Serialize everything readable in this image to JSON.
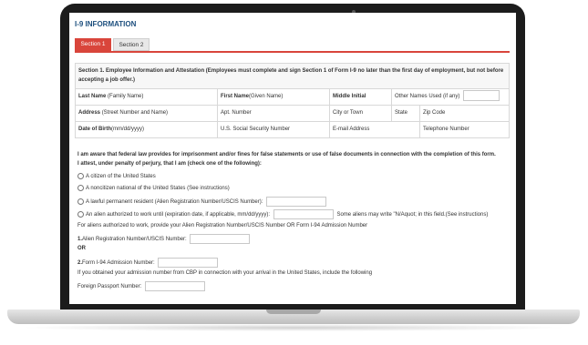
{
  "title": "I-9 INFORMATION",
  "tabs": [
    "Section 1",
    "Section 2"
  ],
  "section_header": "Section 1. Employee Information and Attestation (Employees must complete and sign Section 1 of Form I-9 no later than the first day of employment, but not before accepting a job offer.)",
  "row1": {
    "last_name_label": "Last Name",
    "last_name_hint": "(Family Name)",
    "first_name_label": "First Name",
    "first_name_hint": "(Given Name)",
    "middle_initial": "Middle Initial",
    "other_names": "Other Names Used (if any)"
  },
  "row2": {
    "address_label": "Address",
    "address_hint": "(Street Number and Name)",
    "apt": "Apt. Number",
    "city": "City or Town",
    "state": "State",
    "zip": "Zip Code"
  },
  "row3": {
    "dob_label": "Date of Birth",
    "dob_hint": "(mm/dd/yyyy)",
    "ssn": "U.S. Social Security Number",
    "email": "E-mail Address",
    "phone": "Telephone Number"
  },
  "attest1": "I am aware that federal law provides for imprisonment and/or fines for false statements or use of false documents in connection with the completion of this form.",
  "attest2": "I attest, under penalty of perjury, that I am (check one of the following):",
  "options": {
    "citizen": "A citizen of the United States",
    "noncitizen": "A noncitizen national of the United States (See instructions)",
    "lpr": "A lawful permanent resident (Alien Registration Number/USCIS Number):",
    "alien": "An alien authorized to work until (expiration date, if applicable, mm/dd/yyyy):",
    "alien_note": "Some aliens may write \"N/Aquot; in this field.(See instructions)"
  },
  "aliens_provide": "For aliens authorized to work, provide your Alien Registration Number/USCIS Number OR Form I-94 Admission Number",
  "num1": "1.",
  "num1_label": "Alien Registration Number/USCIS Number:",
  "or_label": "OR",
  "num2": "2.",
  "num2_label": "Form I-94 Admission Number:",
  "cbp_note": "If you obtained your admission number from CBP in connection with your arrival in the United States, include the following",
  "passport_label": "Foreign Passport Number:"
}
